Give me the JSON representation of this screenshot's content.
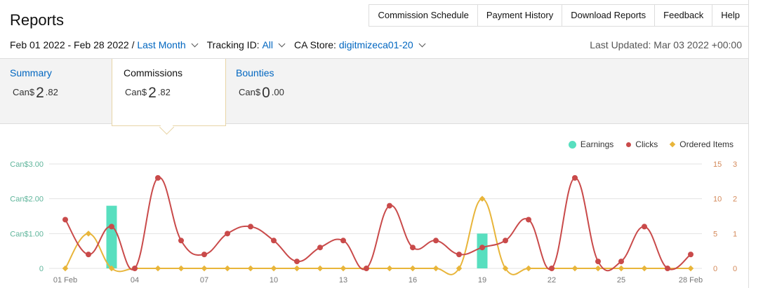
{
  "header": {
    "title": "Reports",
    "nav": [
      "Commission Schedule",
      "Payment History",
      "Download Reports",
      "Feedback",
      "Help"
    ]
  },
  "filters": {
    "date_range": "Feb 01 2022 - Feb 28 2022 /",
    "date_preset": "Last Month",
    "tracking_label": "Tracking ID:",
    "tracking_value": "All",
    "store_label": "CA Store:",
    "store_value": "digitmizeca01-20",
    "last_updated": "Last Updated: Mar 03 2022 +00:00"
  },
  "tabs": [
    {
      "label": "Summary",
      "currency": "Can$",
      "whole": "2",
      "decimal": ".82",
      "active": false
    },
    {
      "label": "Commissions",
      "currency": "Can$",
      "whole": "2",
      "decimal": ".82",
      "active": true
    },
    {
      "label": "Bounties",
      "currency": "Can$",
      "whole": "0",
      "decimal": ".00",
      "active": false
    }
  ],
  "colors": {
    "earnings": "#58dfbf",
    "clicks": "#c94a4a",
    "ordered": "#e8b53a",
    "left_axis": "#5fb59b",
    "right_axis": "#d4895a",
    "link": "#0066c0"
  },
  "chart_data": {
    "type": "bar+line",
    "legend": [
      "Earnings",
      "Clicks",
      "Ordered Items"
    ],
    "legend_position": "top-right",
    "x_ticks": [
      "01 Feb",
      "04",
      "07",
      "10",
      "13",
      "16",
      "19",
      "22",
      "25",
      "28 Feb"
    ],
    "x": [
      1,
      2,
      3,
      4,
      5,
      6,
      7,
      8,
      9,
      10,
      11,
      12,
      13,
      14,
      15,
      16,
      17,
      18,
      19,
      20,
      21,
      22,
      23,
      24,
      25,
      26,
      27,
      28
    ],
    "left_axis": {
      "ticks": [
        "Can$3.00",
        "Can$2.00",
        "Can$1.00",
        "0"
      ],
      "ylim": [
        0,
        3
      ]
    },
    "right_axis_clicks": {
      "ticks": [
        "15",
        "10",
        "5",
        "0"
      ],
      "ylim": [
        0,
        15
      ]
    },
    "right_axis_ordered": {
      "ticks": [
        "3",
        "2",
        "1",
        "0"
      ],
      "ylim": [
        0,
        3
      ]
    },
    "series": [
      {
        "name": "Earnings",
        "type": "bar",
        "values": [
          0,
          0,
          1.8,
          0,
          0,
          0,
          0,
          0,
          0,
          0,
          0,
          0,
          0,
          0,
          0,
          0,
          0,
          0,
          1.0,
          0,
          0,
          0,
          0,
          0,
          0,
          0,
          0,
          0
        ]
      },
      {
        "name": "Clicks",
        "type": "line",
        "values": [
          7,
          2,
          6,
          0,
          13,
          4,
          2,
          5,
          6,
          4,
          1,
          3,
          4,
          0,
          9,
          3,
          4,
          2,
          3,
          4,
          7,
          0,
          13,
          1,
          1,
          6,
          0,
          2
        ]
      },
      {
        "name": "Ordered Items",
        "type": "line",
        "values": [
          0,
          1,
          0,
          0,
          0,
          0,
          0,
          0,
          0,
          0,
          0,
          0,
          0,
          0,
          0,
          0,
          0,
          0,
          2,
          0,
          0,
          0,
          0,
          0,
          0,
          0,
          0,
          0
        ]
      }
    ],
    "grid": true
  }
}
